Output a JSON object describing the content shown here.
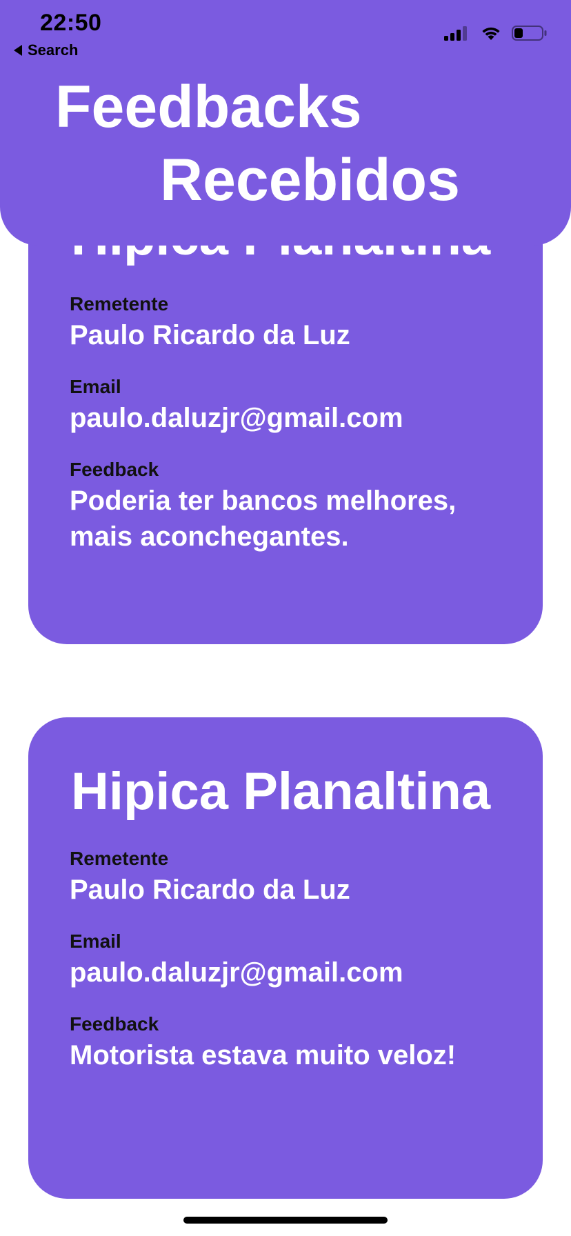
{
  "status_bar": {
    "time": "22:50",
    "icons": [
      "cellular-signal-icon",
      "wifi-icon",
      "battery-icon"
    ]
  },
  "navigation": {
    "back_label": "Search"
  },
  "header": {
    "title_line_1": "Feedbacks",
    "title_line_2": "Recebidos"
  },
  "feedbacks": [
    {
      "title": "Hipica Planaltina",
      "sender_label": "Remetente",
      "sender": "Paulo Ricardo da Luz",
      "email_label": "Email",
      "email": "paulo.daluzjr@gmail.com",
      "feedback_label": "Feedback",
      "feedback": "Poderia ter bancos melhores, mais aconchegantes."
    },
    {
      "title": "Hipica Planaltina",
      "sender_label": "Remetente",
      "sender": "Paulo Ricardo da Luz",
      "email_label": "Email",
      "email": "paulo.daluzjr@gmail.com",
      "feedback_label": "Feedback",
      "feedback": "Motorista estava muito veloz!"
    }
  ],
  "colors": {
    "primary": "#7B5BE0",
    "label": "#111111",
    "text_on_primary": "#FFFFFF",
    "background": "#FFFFFF"
  }
}
